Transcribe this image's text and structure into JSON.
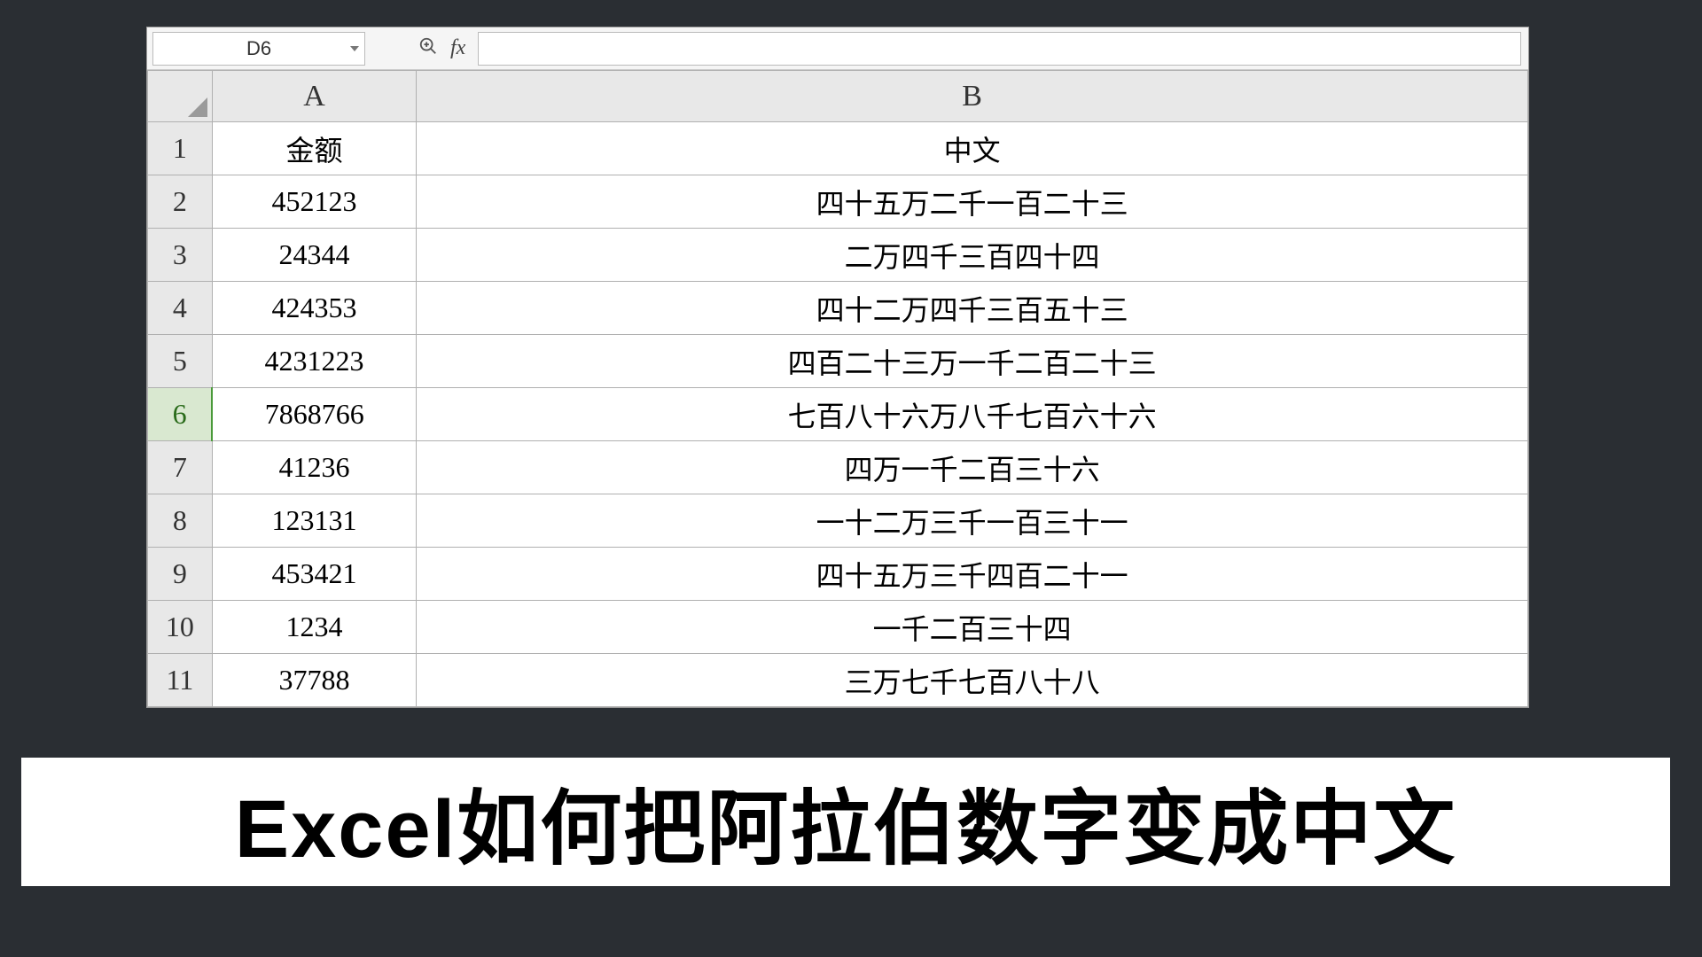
{
  "name_box": "D6",
  "formula_value": "",
  "columns": {
    "a": "A",
    "b": "B"
  },
  "headers": {
    "amount": "金额",
    "chinese": "中文"
  },
  "active_row": 6,
  "rows": [
    {
      "n": "1",
      "a": "金额",
      "b": "中文"
    },
    {
      "n": "2",
      "a": "452123",
      "b": "四十五万二千一百二十三"
    },
    {
      "n": "3",
      "a": "24344",
      "b": "二万四千三百四十四"
    },
    {
      "n": "4",
      "a": "424353",
      "b": "四十二万四千三百五十三"
    },
    {
      "n": "5",
      "a": "4231223",
      "b": "四百二十三万一千二百二十三"
    },
    {
      "n": "6",
      "a": "7868766",
      "b": "七百八十六万八千七百六十六"
    },
    {
      "n": "7",
      "a": "41236",
      "b": "四万一千二百三十六"
    },
    {
      "n": "8",
      "a": "123131",
      "b": "一十二万三千一百三十一"
    },
    {
      "n": "9",
      "a": "453421",
      "b": "四十五万三千四百二十一"
    },
    {
      "n": "10",
      "a": "1234",
      "b": "一千二百三十四"
    },
    {
      "n": "11",
      "a": "37788",
      "b": "三万七千七百八十八"
    }
  ],
  "fx_label": "fx",
  "banner_title": "Excel如何把阿拉伯数字变成中文"
}
